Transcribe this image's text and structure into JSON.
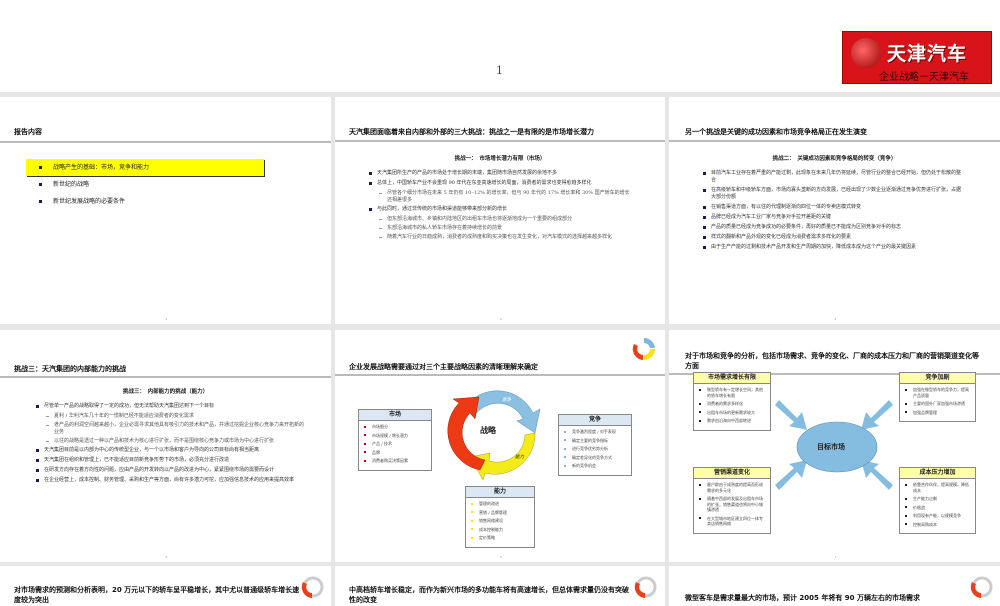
{
  "cover": {
    "page_number": "1",
    "logo_text": "天津汽车",
    "logo_slogan": "企业战略－天津汽车"
  },
  "slides": [
    {
      "page": "2",
      "title": "报告内容",
      "items": [
        "战略产生的基础：市场，竞争和能力",
        "新世纪的战略",
        "新世纪发展战略的必要条件"
      ]
    },
    {
      "page": "3",
      "title": "天汽集团面临着来自内部和外部的三大挑战：挑战之一是有限的是市场增长潜力",
      "subtitle": "挑战一：　市场增长潜力有限（市场）",
      "bullets": [
        "天汽集团所生产的产品的市场处于增长期的末端，集团随市场自然发展的余地不多",
        "总体上，中国轿车产业不会重现 90 年代在东亚高速增长的局面，消费者的需求也变得愈趋多样化",
        "尽管各个细分市场在未来 5 年仍有 10–12% 的增长率，但与 90 年代的 17% 增长率和 30% 国产轿车的增长还相差很多",
        "与此同时，通过非传统的市场和渠道能够带来部分新的增长",
        "但东部沿海城市、乡镇和内陆地区的出租车市场也将逐渐地成为一个重要的组成部分",
        "东部沿海城市的私人轿车市场存在着持续增长的前景",
        "随着汽车行业的日趋成熟，消费者的成熟度和购买决策也在发生变化，对汽车模式的选择越来越多样化"
      ]
    },
    {
      "page": "4",
      "title": "另一个挑战是关键的成功因素和市场竞争格局正在发生演变",
      "subtitle": "挑战二：　关键成功因素和竞争格局的转变（竞争）",
      "bullets": [
        "目前汽车工业存在着严重的产能过剩，此现象在未来几年仍将延续，尽管行业的整合已经开始，但仍处于松散的整合",
        "在高级轿车和中级轿车方面，市场向寡头垄断的方向发展，已经出现了少数企业逐渐通过竞争优势进行扩张，占据大部分份额",
        "在销售渠道方面，有以往的代理制逐渐向四位一体的专卖店模式转变",
        "品牌已经成为汽车工业厂家与竞争对手拉开差距的关键",
        "产品的质量已经成为竞争成功的必要条件，再好的质量已不能成为区别竞争对手的标志",
        "样式的翻新和产品外观的变化已经成为消费者需求多样化的要素",
        "由于生产产能的过剩和技术产品开发和生产周期的加快，降低成本成为这个产业的最关键因素"
      ]
    },
    {
      "page": "5",
      "title": "挑战三：天汽集团的内部能力的挑战",
      "subtitle": "挑战三：　内部能力的挑战（能力）",
      "bullets": [
        "尽管单一产品的战略取得了一定的成功，但无法帮助天汽集团达到下一个目标",
        "夏利 / 华利汽车几十年的一惯制已经不能适应消费者的变化需求",
        "老产品的利润空间越来越小，企业必需寻求其他具有吸引力的技术和产品，并通过挖掘企业核心竞争力来开拓新的业务",
        "以往的战略是透过一种以产品和技术为核心进行扩张，而不是围绕核心竞争力或市场为中心进行扩张",
        "天汽集团目前是以内部为中心的传统型企业，与一个以市场和客户为导向的公司目标尚有相当距离",
        "天汽集团在组织和管理上，已不能适应目前新竞争形势下的市场，必须充分进行改造",
        "在研发方向存在着方向性的问题，应由产品的开发转向以产品的改进为中心，紧紧围绕市场的需要而设计",
        "在企业经营上，成本控制、财务管理、采购和生产等方面，尚有许多潜力可挖，应加强信息技术的应用来提高效率"
      ]
    },
    {
      "page": "6",
      "title": "企业发展战略需要通过对三个主要战略因素的清晰理解来确定",
      "center": "战略",
      "arrows": [
        "竞争",
        "市场",
        "能力"
      ],
      "boxes": {
        "market": {
          "title": "市场",
          "items": [
            "市场细分",
            "市场规模 / 增长潜力",
            "产品 / 技术",
            "品牌",
            "消费者购买决策因素"
          ]
        },
        "competition": {
          "title": "竞争",
          "items": [
            "竞争激烈程度 / 对手表现",
            "确定主要的竞争指标",
            "进行竞争优劣势分析",
            "确定差异化的竞争方式",
            "新的竞争机会"
          ]
        },
        "capability": {
          "title": "能力",
          "items": [
            "管理的改进",
            "营销 / 品牌管理",
            "销售网络建设",
            "成本控制能力",
            "定价策略"
          ]
        }
      }
    },
    {
      "page": "7",
      "title": "对于市场和竞争的分析，包括市场需求、竞争的变化、厂商的成本压力和厂商的营销渠道变化等方面",
      "center": "目标市场",
      "boxes": {
        "demand": {
          "title": "市场需求增长有限",
          "items": [
            "微型轿车有一定增长空间，其他的轿车增长有限",
            "消费者的需求多样化",
            "出租车市场的更新需求较大",
            "需求由沿海向中西部转进"
          ]
        },
        "competition": {
          "title": "竞争加剧",
          "items": [
            "加强在微型轿车的竞争力，提高产品质量",
            "主要的国外厂家加强市场渗透",
            "加强品牌管理"
          ]
        },
        "channel": {
          "title": "营销渠道变化",
          "items": [
            "客户群由于成熟度的提高而形成需求的多元化",
            "随着中西部的发展及出租车市场的扩张，销售渠道也将向中小城镇渗透",
            "在大型城市地区建立四位一体专卖店销售网络"
          ]
        },
        "cost": {
          "title": "成本压力增加",
          "items": [
            "依靠合作伙伴，提高规模，降低成本",
            "生产能力过剩",
            "价格战",
            "利用现有产能，以规模竞争",
            "控制采购成本"
          ]
        }
      }
    },
    {
      "title": "对市场需求的预测和分析表明，20 万元以下的轿车呈平稳增长，其中尤以普通级轿车增长速度较为突出"
    },
    {
      "title": "中高档轿车增长稳定，而作为新兴市场的多功能车将有高速增长，但总体需求量仍没有突破性的改变"
    },
    {
      "title": "微型客车是需求量最大的市场，预计 2005 年将有 90 万辆左右的市场需求"
    }
  ]
}
